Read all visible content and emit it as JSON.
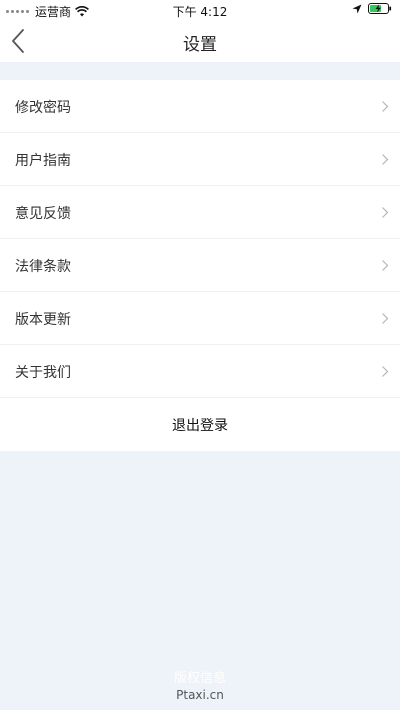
{
  "status_bar": {
    "carrier": "运营商",
    "time": "下午 4:12"
  },
  "nav": {
    "title": "设置"
  },
  "menu": {
    "items": [
      {
        "label": "修改密码"
      },
      {
        "label": "用户指南"
      },
      {
        "label": "意见反馈"
      },
      {
        "label": "法律条款"
      },
      {
        "label": "版本更新"
      },
      {
        "label": "关于我们"
      }
    ],
    "logout_label": "退出登录"
  },
  "footer": {
    "title": "版权信息",
    "site": "Ptaxi.cn"
  },
  "colors": {
    "background": "#eef2f9",
    "battery_green": "#34c759"
  },
  "icons": {
    "back": "back-chevron-icon",
    "chevron": "chevron-right-icon",
    "wifi": "wifi-icon",
    "location": "location-arrow-icon",
    "battery": "battery-charging-icon"
  }
}
